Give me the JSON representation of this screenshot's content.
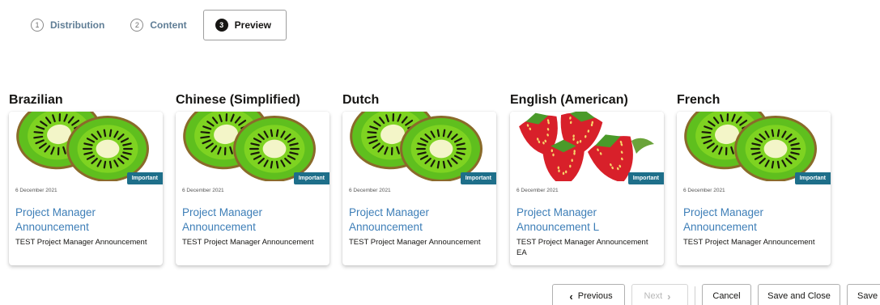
{
  "wizard": {
    "steps": [
      {
        "number": "1",
        "label": "Distribution"
      },
      {
        "number": "2",
        "label": "Content"
      },
      {
        "number": "3",
        "label": "Preview"
      }
    ]
  },
  "cards": [
    {
      "language": "Brazilian",
      "image": "kiwi",
      "badge": "Important",
      "date": "6 December 2021",
      "title": "Project Manager Announcement",
      "description": "TEST Project Manager Announcement"
    },
    {
      "language": "Chinese (Simplified)",
      "image": "kiwi",
      "badge": "Important",
      "date": "6 December 2021",
      "title": "Project Manager Announcement",
      "description": "TEST Project Manager Announcement"
    },
    {
      "language": "Dutch",
      "image": "kiwi",
      "badge": "Important",
      "date": "6 December 2021",
      "title": "Project Manager Announcement",
      "description": "TEST Project Manager Announcement"
    },
    {
      "language": "English (American)",
      "image": "strawberry",
      "badge": "Important",
      "date": "6 December 2021",
      "title": "Project Manager Announcement L",
      "description": "TEST Project Manager Announcement EA"
    },
    {
      "language": "French",
      "image": "kiwi",
      "badge": "Important",
      "date": "6 December 2021",
      "title": "Project Manager Announcement",
      "description": "TEST Project Manager Announcement"
    }
  ],
  "footer": {
    "previous_label": "Previous",
    "next_label": "Next",
    "cancel_label": "Cancel",
    "save_close_label": "Save and Close",
    "save_label": "Save"
  },
  "colors": {
    "badge": "#1e6f8a",
    "card_title": "#3d7eb7",
    "step_link": "#5f7d95"
  }
}
